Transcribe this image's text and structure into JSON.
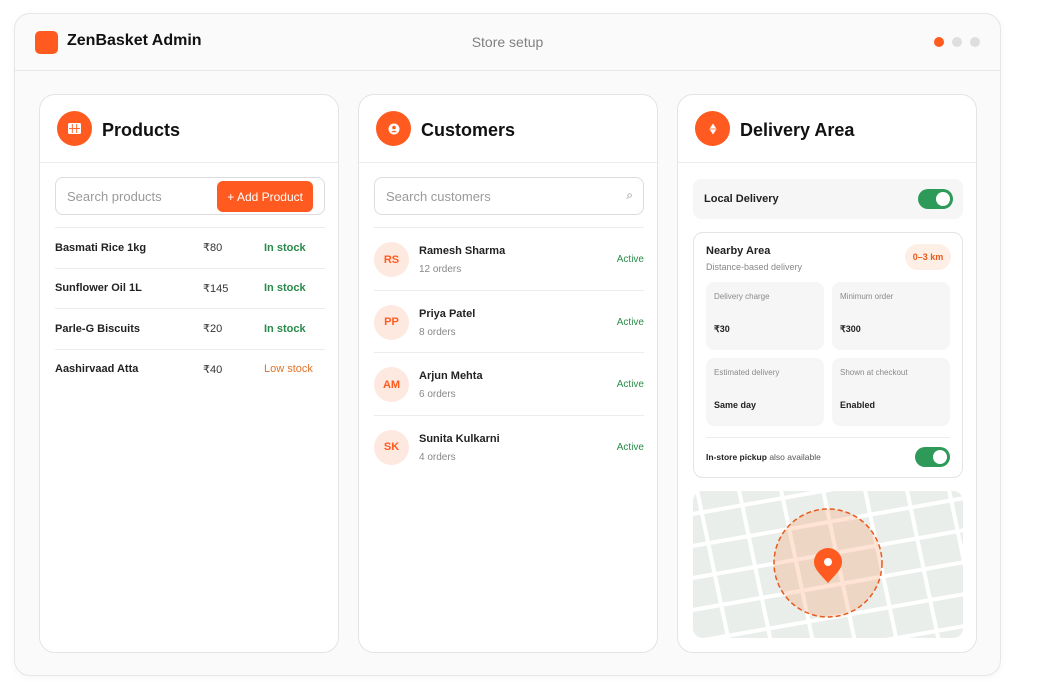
{
  "app": {
    "title": "ZenBasket Admin",
    "subtitle": "Store setup",
    "accent": "#ff5a1f"
  },
  "products": {
    "title": "Products",
    "icon": "grid-icon",
    "search_placeholder": "Search products",
    "add_label": "+ Add Product",
    "items": [
      {
        "name": "Basmati Rice 1kg",
        "price": "₹80",
        "status": "In stock"
      },
      {
        "name": "Sunflower Oil 1L",
        "price": "₹145",
        "status": "In stock"
      },
      {
        "name": "Parle-G Biscuits",
        "price": "₹20",
        "status": "In stock"
      },
      {
        "name": "Aashirvaad Atta",
        "price": "₹40",
        "status": "Low stock"
      }
    ]
  },
  "customers": {
    "title": "Customers",
    "icon": "user-icon",
    "search_placeholder": "Search customers",
    "items": [
      {
        "initials": "RS",
        "name": "Ramesh Sharma",
        "orders": "12 orders",
        "status": "Active"
      },
      {
        "initials": "PP",
        "name": "Priya Patel",
        "orders": "8 orders",
        "status": "Active"
      },
      {
        "initials": "AM",
        "name": "Arjun Mehta",
        "orders": "6 orders",
        "status": "Active"
      },
      {
        "initials": "SK",
        "name": "Sunita Kulkarni",
        "orders": "4 orders",
        "status": "Active"
      }
    ]
  },
  "delivery": {
    "title": "Delivery Area",
    "icon": "location-icon",
    "local_label": "Local Delivery",
    "local_enabled": true,
    "nearby": {
      "title": "Nearby Area",
      "subtitle": "Distance-based delivery",
      "range": "0–3 km",
      "tiles": [
        {
          "label": "Delivery charge",
          "value": "₹30"
        },
        {
          "label": "Minimum order",
          "value": "₹300"
        },
        {
          "label": "Estimated delivery",
          "value": "Same day"
        },
        {
          "label": "Shown at checkout",
          "value": "Enabled"
        }
      ],
      "pickup_bold": "In-store pickup",
      "pickup_rest": "also available",
      "pickup_enabled": true
    }
  }
}
